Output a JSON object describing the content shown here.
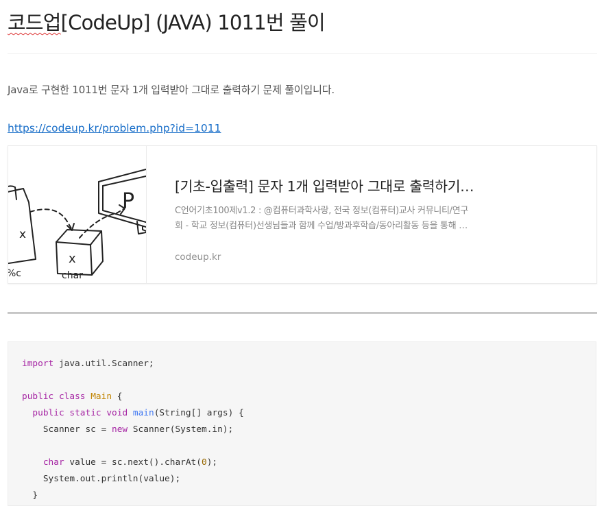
{
  "post": {
    "title_prefix": "코드업",
    "title_rest": "[CodeUp] (JAVA) 1011번 풀이",
    "intro": "Java로 구현한 1011번 문자 1개 입력받아 그대로 출력하기 문제 풀이입니다.",
    "link": "https://codeup.kr/problem.php?id=1011"
  },
  "card": {
    "title": "[기초-입출력] 문자 1개 입력받아 그대로 출력하기…",
    "desc_line1": "C언어기초100제v1.2 : @컴퓨터과학사랑, 전국 정보(컴퓨터)교사 커뮤니티/연구",
    "desc_line2": "회 - 학교 정보(컴퓨터)선생님들과 함께 수업/방과후학습/동아리활동 등을 통해 …",
    "domain": "codeup.kr",
    "thumb_text": {
      "var": "x",
      "box_label": "x",
      "box_caption": "char",
      "screen": "P",
      "format": "%c"
    }
  },
  "code": {
    "line1_kw": "import",
    "line1_rest": " java.util.Scanner;",
    "line3_kw1": "public",
    "line3_kw2": "class",
    "line3_cls": "Main",
    "line3_rest": " {",
    "line4_kw1": "public",
    "line4_kw2": "static",
    "line4_kw3": "void",
    "line4_fn": "main",
    "line4_rest": "(String[] args) {",
    "line5_a": "Scanner sc = ",
    "line5_kw": "new",
    "line5_b": " Scanner(System.in);",
    "line7_kw": "char",
    "line7_a": " value = sc.next().charAt(",
    "line7_num": "0",
    "line7_b": ");",
    "line8": "System.out.println(value);",
    "line9": "}"
  }
}
